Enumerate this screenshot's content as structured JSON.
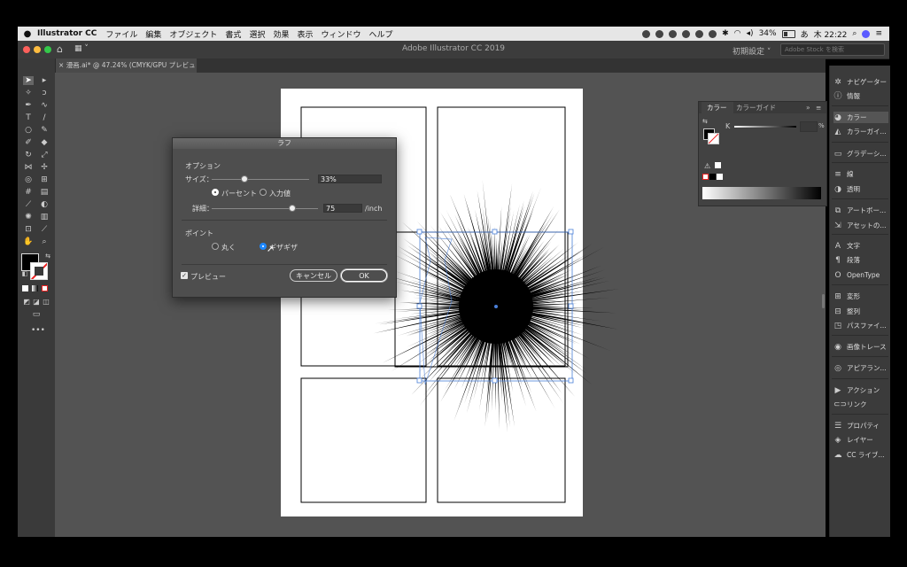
{
  "menubar": {
    "app_name": "Illustrator CC",
    "items": [
      "ファイル",
      "編集",
      "オブジェクト",
      "書式",
      "選択",
      "効果",
      "表示",
      "ウィンドウ",
      "ヘルプ"
    ],
    "battery": "34%",
    "clock": "木 22:22"
  },
  "titlebar": {
    "title": "Adobe Illustrator CC 2019",
    "workspace": "初期設定",
    "stock_placeholder": "Adobe Stock を検索"
  },
  "document_tab": {
    "label": "漫画.ai* @ 47.24% (CMYK/GPU プレビュー)"
  },
  "dialog": {
    "title": "ラフ",
    "options_heading": "オプション",
    "size_label": "サイズ：",
    "size_value": "33%",
    "size_level": 0.33,
    "unit_percent": "パーセント",
    "unit_input": "入力値",
    "detail_label": "詳細：",
    "detail_value": "75",
    "detail_unit": "/inch",
    "detail_level": 0.75,
    "point_heading": "ポイント",
    "point_round": "丸く",
    "point_jagged": "ギザギザ",
    "preview_label": "プレビュー",
    "cancel_label": "キャンセル",
    "ok_label": "OK"
  },
  "color_panel": {
    "tab_color": "カラー",
    "tab_guide": "カラーガイド",
    "channel": "K",
    "percent": "%"
  },
  "dock": {
    "items": [
      {
        "icon": "compass-icon",
        "label": "ナビゲーター"
      },
      {
        "icon": "info-icon",
        "label": "情報"
      },
      {
        "icon": "palette-icon",
        "label": "カラー"
      },
      {
        "icon": "color-guide-icon",
        "label": "カラーガイ..."
      },
      {
        "icon": "gradient-icon",
        "label": "グラデーシ..."
      },
      {
        "icon": "stroke-icon",
        "label": "線"
      },
      {
        "icon": "transparency-icon",
        "label": "透明"
      },
      {
        "icon": "artboard-icon",
        "label": "アートボー..."
      },
      {
        "icon": "asset-icon",
        "label": "アセットの..."
      },
      {
        "icon": "type-icon",
        "label": "文字"
      },
      {
        "icon": "paragraph-icon",
        "label": "段落"
      },
      {
        "icon": "opentype-icon",
        "label": "OpenType"
      },
      {
        "icon": "transform-icon",
        "label": "変形"
      },
      {
        "icon": "align-icon",
        "label": "整列"
      },
      {
        "icon": "pathfinder-icon",
        "label": "パスファイ..."
      },
      {
        "icon": "image-trace-icon",
        "label": "画像トレース"
      },
      {
        "icon": "appearance-icon",
        "label": "アピアラン..."
      },
      {
        "icon": "play-icon",
        "label": "アクション"
      },
      {
        "icon": "link-icon",
        "label": "リンク"
      },
      {
        "icon": "properties-icon",
        "label": "プロパティ"
      },
      {
        "icon": "layers-icon",
        "label": "レイヤー"
      },
      {
        "icon": "cc-libraries-icon",
        "label": "CC ライブ..."
      }
    ]
  },
  "colors": {
    "canvas": "#535353",
    "accent_blue": "#1e88ff",
    "selection": "#4a7fd8"
  }
}
